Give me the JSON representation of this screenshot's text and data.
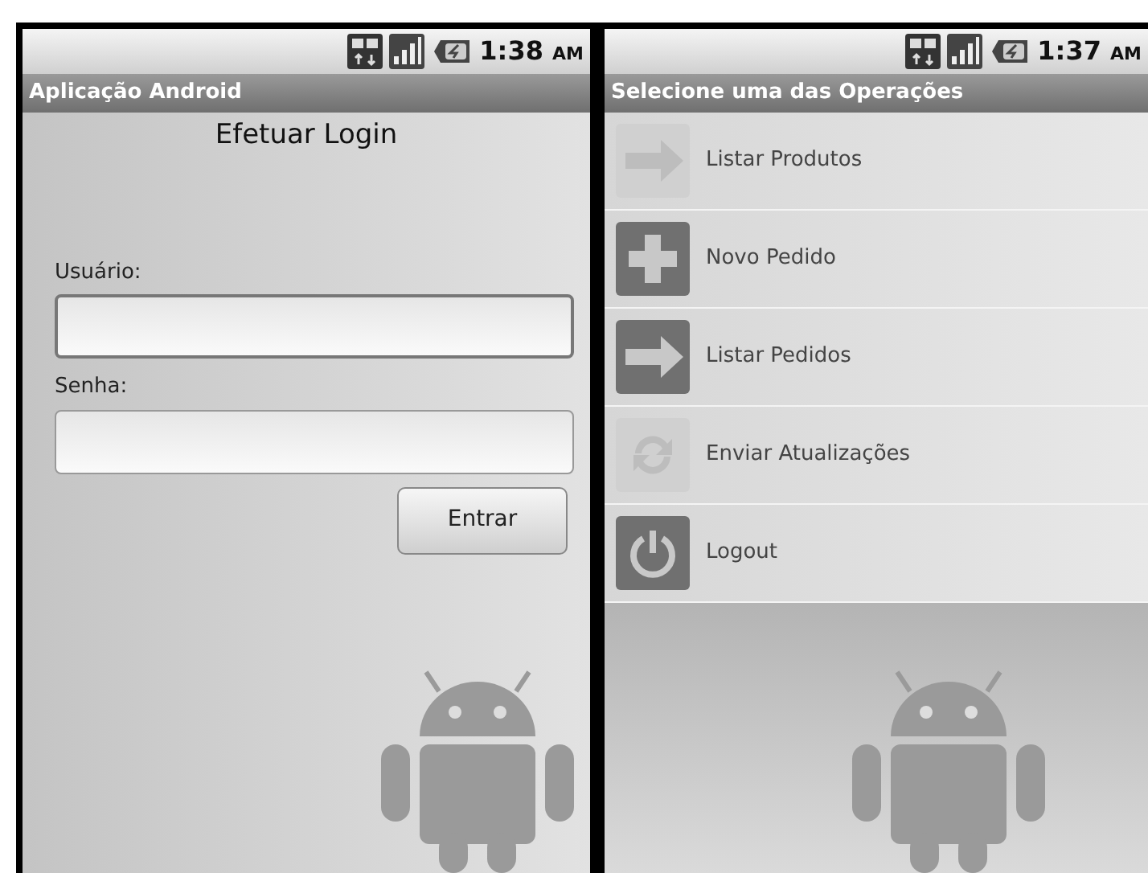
{
  "screens": [
    {
      "status_bar": {
        "time": "1:38",
        "ampm": "AM"
      },
      "title": "Aplicação Android",
      "kind": "login",
      "heading": "Efetuar Login",
      "fields": [
        {
          "label": "Usuário:",
          "focused": true
        },
        {
          "label": "Senha:",
          "focused": false
        }
      ],
      "button": "Entrar"
    },
    {
      "status_bar": {
        "time": "1:37",
        "ampm": "AM"
      },
      "title": "Selecione uma das Operações",
      "kind": "menu",
      "items": [
        {
          "label": "Listar Produtos",
          "kind": "arrow",
          "faded": true
        },
        {
          "label": "Novo Pedido",
          "kind": "plus",
          "faded": false
        },
        {
          "label": "Listar Pedidos",
          "kind": "arrow",
          "faded": false
        },
        {
          "label": "Enviar Atualizações",
          "kind": "refresh",
          "faded": true
        },
        {
          "label": "Logout",
          "kind": "power",
          "faded": false
        }
      ]
    }
  ]
}
